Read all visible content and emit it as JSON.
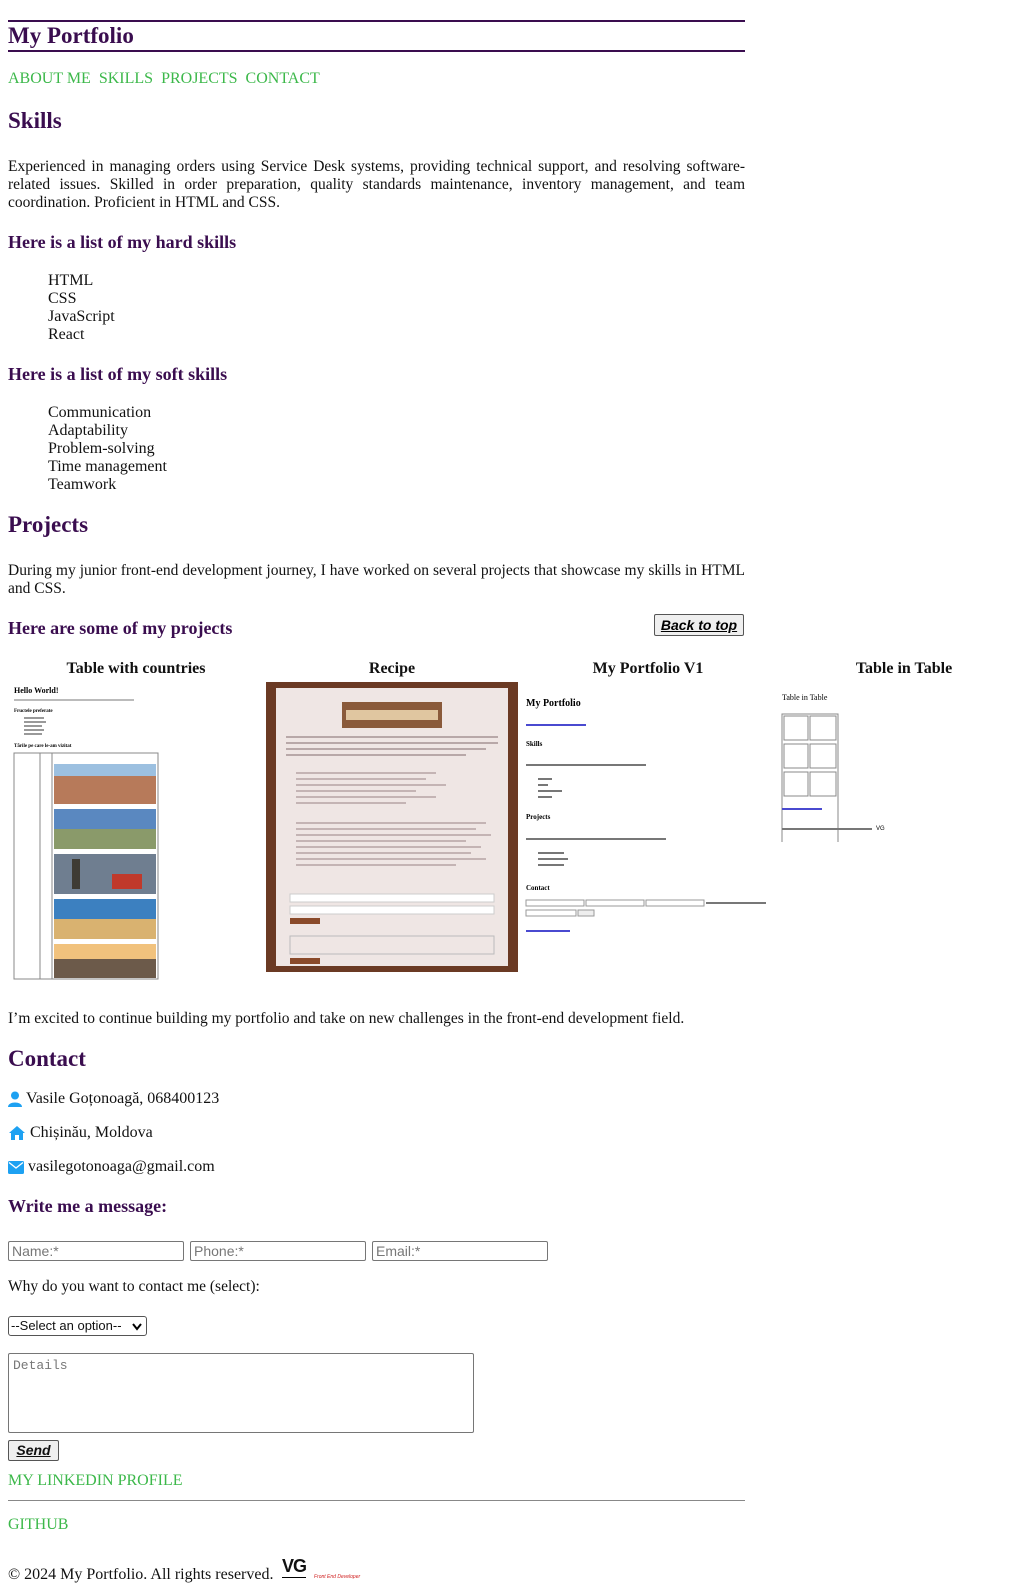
{
  "header": {
    "title": "My Portfolio"
  },
  "nav": {
    "items": [
      "ABOUT ME",
      "SKILLS",
      "PROJECTS",
      "CONTACT"
    ]
  },
  "skills": {
    "heading": "Skills",
    "intro": "Experienced in managing orders using Service Desk systems, providing technical support, and resolving software-related issues. Skilled in order preparation, quality standards maintenance, inventory management, and team coordination. Proficient in HTML and CSS.",
    "hard_heading": "Here is a list of my hard skills",
    "hard": [
      "HTML",
      "CSS",
      "JavaScript",
      "React"
    ],
    "soft_heading": "Here is a list of my soft skills",
    "soft": [
      "Communication",
      "Adaptability",
      "Problem-solving",
      "Time management",
      "Teamwork"
    ]
  },
  "projects": {
    "heading": "Projects",
    "intro": "During my junior front-end development journey, I have worked on several projects that showcase my skills in HTML and CSS.",
    "list_heading": "Here are some of my projects",
    "back_to_top": "Back to top",
    "items": [
      {
        "title": "Table with countries"
      },
      {
        "title": "Recipe"
      },
      {
        "title": "My Portfolio V1"
      },
      {
        "title": "Table in Table"
      }
    ],
    "outro": "I’m excited to continue building my portfolio and take on new challenges in the front-end development field."
  },
  "contact": {
    "heading": "Contact",
    "name_phone": "Vasile Goțonoagă, 068400123",
    "location": "Chișinău, Moldova",
    "email": "vasilegotonoaga@gmail.com",
    "form_heading": "Write me a message:",
    "name_placeholder": "Name:*",
    "phone_placeholder": "Phone:*",
    "email_placeholder": "Email:*",
    "reason_label": "Why do you want to contact me (select):",
    "select_value": "--Select an option--",
    "details_placeholder": "Details",
    "send_label": "Send"
  },
  "footer": {
    "linkedin": "MY LINKEDIN PROFILE",
    "github": "GITHUB",
    "copyright": "© 2024 My Portfolio. All rights reserved.",
    "logo_text": "VG",
    "logo_sub": "Front End Developer"
  },
  "colors": {
    "heading": "#3a0d4f",
    "link": "#3cb84a",
    "icon": "#1da1f2"
  }
}
